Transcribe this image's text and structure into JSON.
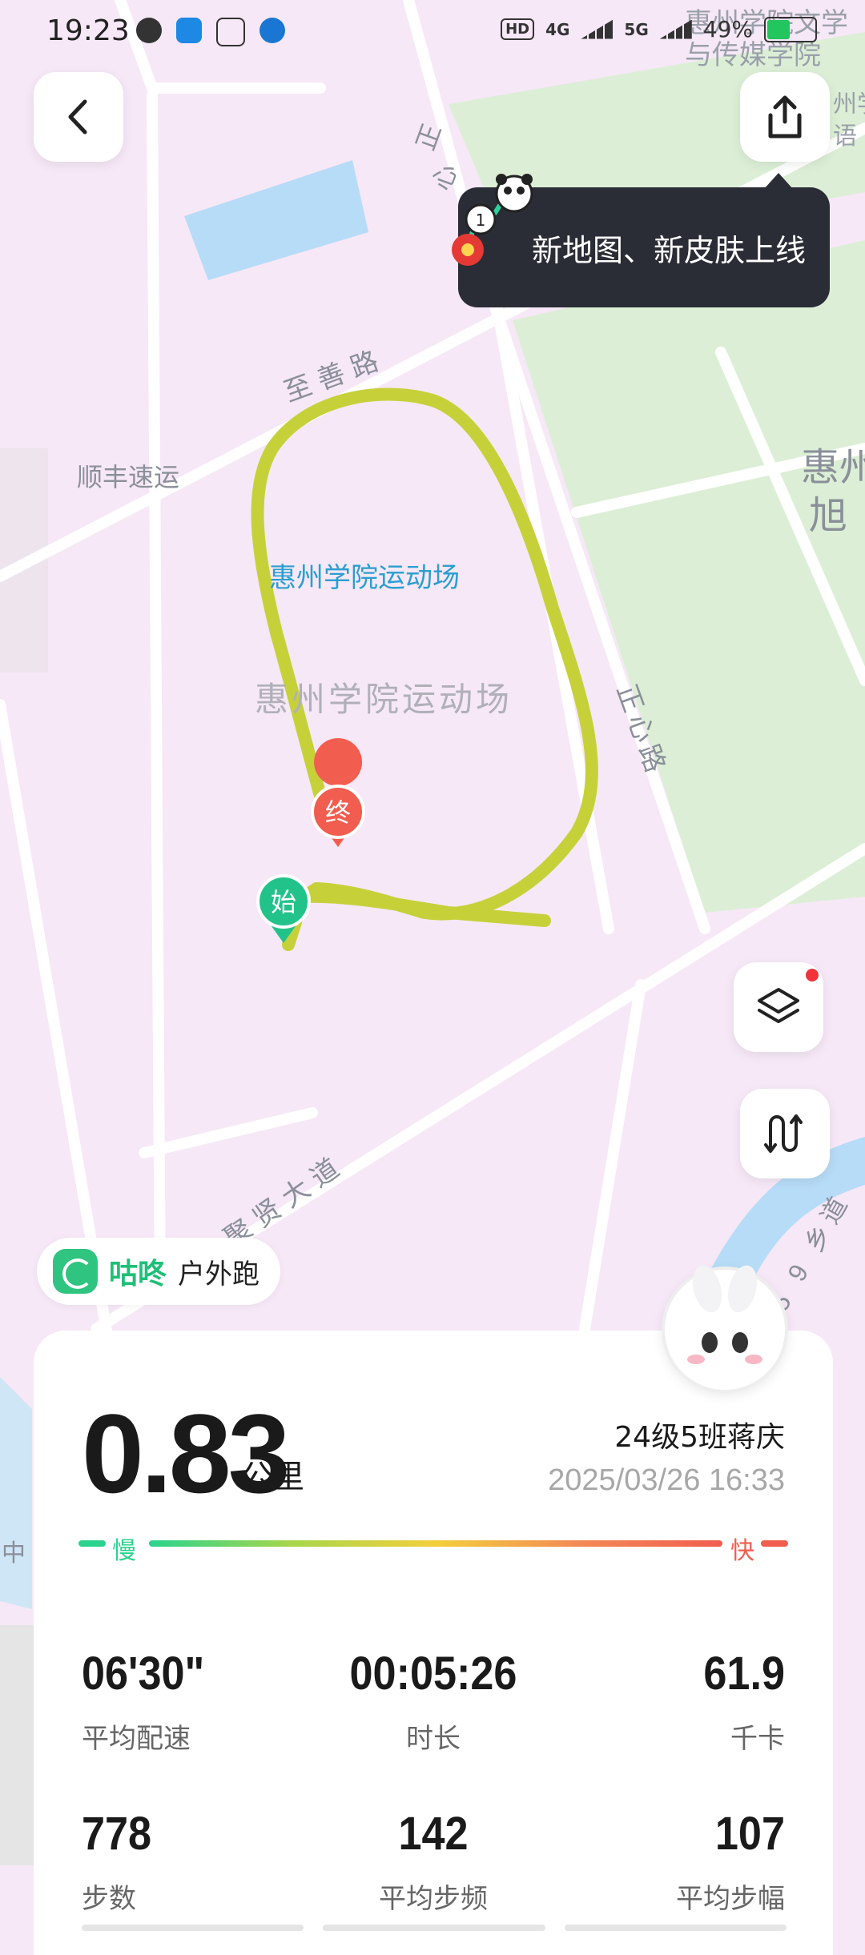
{
  "status_bar": {
    "time": "19:23",
    "network_hd": "HD",
    "network_4g": "4G",
    "network_5g": "5G",
    "battery": "49%"
  },
  "map": {
    "labels": {
      "top_right_1": "惠州学院文学",
      "top_right_2": "与传媒学院",
      "right_1": "州学",
      "right_2": "语",
      "road_zheng_1": "正",
      "road_zheng_2": "心",
      "road_zhishan": "至善路",
      "shunfeng": "顺丰速运",
      "stadium_blue": "惠州学院运动场",
      "stadium_gray": "惠州学院运动场",
      "road_zhengxin": "正心路",
      "right_hui": "惠州",
      "right_xu": "旭",
      "road_juxian": "聚贤大道",
      "road_59": "5 9 乡道",
      "left_zhong": "中"
    },
    "markers": {
      "start": "始",
      "end": "终"
    },
    "route_color": "#c6d13a"
  },
  "tooltip": {
    "text": "新地图、新皮肤上线",
    "badge_number": "1"
  },
  "badge": {
    "brand": "咕咚",
    "activity": "户外跑"
  },
  "summary": {
    "distance": "0.83",
    "unit": "公里",
    "user": "24级5班蒋庆",
    "datetime": "2025/03/26 16:33",
    "slow_label": "慢",
    "fast_label": "快"
  },
  "stats": [
    {
      "value": "06'30\"",
      "label": "平均配速"
    },
    {
      "value": "00:05:26",
      "label": "时长"
    },
    {
      "value": "61.9",
      "label": "千卡"
    },
    {
      "value": "778",
      "label": "步数"
    },
    {
      "value": "142",
      "label": "平均步频"
    },
    {
      "value": "107",
      "label": "平均步幅"
    }
  ],
  "colors": {
    "accent_green": "#1fbf78",
    "end_red": "#f15d4f",
    "map_bg": "#f6e8f6",
    "campus_green": "#dcefd6"
  }
}
